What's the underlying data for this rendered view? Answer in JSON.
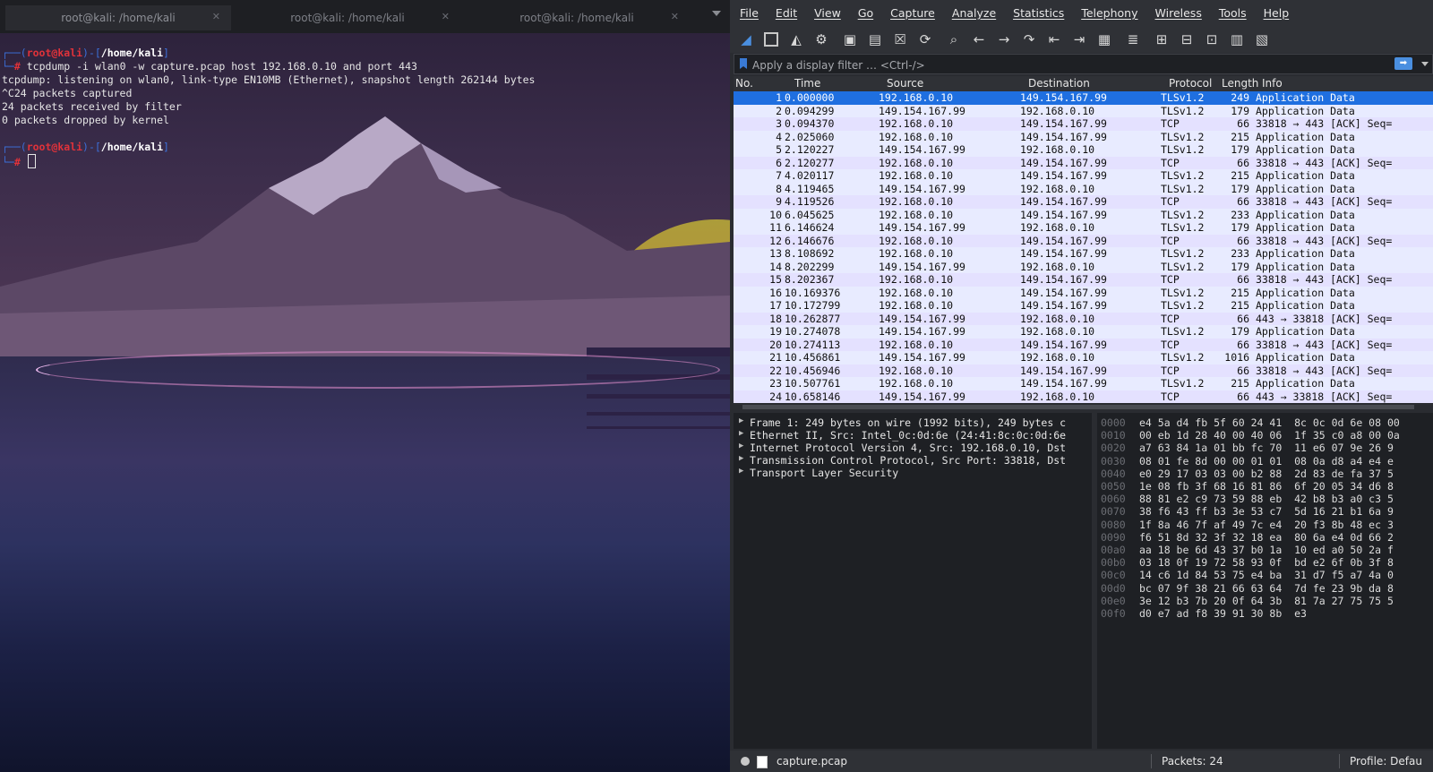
{
  "terminal": {
    "tabs": [
      {
        "label": "root@kali: /home/kali",
        "active": true
      },
      {
        "label": "root@kali: /home/kali",
        "active": false
      },
      {
        "label": "root@kali: /home/kali",
        "active": false
      }
    ],
    "prompt": {
      "user": "root@kali",
      "path": "/home/kali",
      "symbol": "#"
    },
    "command": "tcpdump -i wlan0 -w capture.pcap host 192.168.0.10 and port 443",
    "output": [
      "tcpdump: listening on wlan0, link-type EN10MB (Ethernet), snapshot length 262144 bytes",
      "^C24 packets captured",
      "24 packets received by filter",
      "0 packets dropped by kernel"
    ]
  },
  "wireshark": {
    "menu": [
      "File",
      "Edit",
      "View",
      "Go",
      "Capture",
      "Analyze",
      "Statistics",
      "Telephony",
      "Wireless",
      "Tools",
      "Help"
    ],
    "filter_placeholder": "Apply a display filter … <Ctrl-/>",
    "columns": [
      "No.",
      "Time",
      "Source",
      "Destination",
      "Protocol",
      "Length",
      "Info"
    ],
    "packets": [
      [
        "1",
        "0.000000",
        "192.168.0.10",
        "149.154.167.99",
        "TLSv1.2",
        "249",
        "Application Data"
      ],
      [
        "2",
        "0.094299",
        "149.154.167.99",
        "192.168.0.10",
        "TLSv1.2",
        "179",
        "Application Data"
      ],
      [
        "3",
        "0.094370",
        "192.168.0.10",
        "149.154.167.99",
        "TCP",
        "66",
        "33818 → 443 [ACK] Seq="
      ],
      [
        "4",
        "2.025060",
        "192.168.0.10",
        "149.154.167.99",
        "TLSv1.2",
        "215",
        "Application Data"
      ],
      [
        "5",
        "2.120227",
        "149.154.167.99",
        "192.168.0.10",
        "TLSv1.2",
        "179",
        "Application Data"
      ],
      [
        "6",
        "2.120277",
        "192.168.0.10",
        "149.154.167.99",
        "TCP",
        "66",
        "33818 → 443 [ACK] Seq="
      ],
      [
        "7",
        "4.020117",
        "192.168.0.10",
        "149.154.167.99",
        "TLSv1.2",
        "215",
        "Application Data"
      ],
      [
        "8",
        "4.119465",
        "149.154.167.99",
        "192.168.0.10",
        "TLSv1.2",
        "179",
        "Application Data"
      ],
      [
        "9",
        "4.119526",
        "192.168.0.10",
        "149.154.167.99",
        "TCP",
        "66",
        "33818 → 443 [ACK] Seq="
      ],
      [
        "10",
        "6.045625",
        "192.168.0.10",
        "149.154.167.99",
        "TLSv1.2",
        "233",
        "Application Data"
      ],
      [
        "11",
        "6.146624",
        "149.154.167.99",
        "192.168.0.10",
        "TLSv1.2",
        "179",
        "Application Data"
      ],
      [
        "12",
        "6.146676",
        "192.168.0.10",
        "149.154.167.99",
        "TCP",
        "66",
        "33818 → 443 [ACK] Seq="
      ],
      [
        "13",
        "8.108692",
        "192.168.0.10",
        "149.154.167.99",
        "TLSv1.2",
        "233",
        "Application Data"
      ],
      [
        "14",
        "8.202299",
        "149.154.167.99",
        "192.168.0.10",
        "TLSv1.2",
        "179",
        "Application Data"
      ],
      [
        "15",
        "8.202367",
        "192.168.0.10",
        "149.154.167.99",
        "TCP",
        "66",
        "33818 → 443 [ACK] Seq="
      ],
      [
        "16",
        "10.169376",
        "192.168.0.10",
        "149.154.167.99",
        "TLSv1.2",
        "215",
        "Application Data"
      ],
      [
        "17",
        "10.172799",
        "192.168.0.10",
        "149.154.167.99",
        "TLSv1.2",
        "215",
        "Application Data"
      ],
      [
        "18",
        "10.262877",
        "149.154.167.99",
        "192.168.0.10",
        "TCP",
        "66",
        "443 → 33818 [ACK] Seq="
      ],
      [
        "19",
        "10.274078",
        "149.154.167.99",
        "192.168.0.10",
        "TLSv1.2",
        "179",
        "Application Data"
      ],
      [
        "20",
        "10.274113",
        "192.168.0.10",
        "149.154.167.99",
        "TCP",
        "66",
        "33818 → 443 [ACK] Seq="
      ],
      [
        "21",
        "10.456861",
        "149.154.167.99",
        "192.168.0.10",
        "TLSv1.2",
        "1016",
        "Application Data"
      ],
      [
        "22",
        "10.456946",
        "192.168.0.10",
        "149.154.167.99",
        "TCP",
        "66",
        "33818 → 443 [ACK] Seq="
      ],
      [
        "23",
        "10.507761",
        "192.168.0.10",
        "149.154.167.99",
        "TLSv1.2",
        "215",
        "Application Data"
      ],
      [
        "24",
        "10.658146",
        "149.154.167.99",
        "192.168.0.10",
        "TCP",
        "66",
        "443 → 33818 [ACK] Seq="
      ]
    ],
    "selected_row": 0,
    "details": [
      "Frame 1: 249 bytes on wire (1992 bits), 249 bytes c",
      "Ethernet II, Src: Intel_0c:0d:6e (24:41:8c:0c:0d:6e",
      "Internet Protocol Version 4, Src: 192.168.0.10, Dst",
      "Transmission Control Protocol, Src Port: 33818, Dst",
      "Transport Layer Security"
    ],
    "hex": [
      [
        "0000",
        "e4 5a d4 fb 5f 60 24 41  8c 0c 0d 6e 08 00"
      ],
      [
        "0010",
        "00 eb 1d 28 40 00 40 06  1f 35 c0 a8 00 0a"
      ],
      [
        "0020",
        "a7 63 84 1a 01 bb fc 70  11 e6 07 9e 26 9"
      ],
      [
        "0030",
        "08 01 fe 8d 00 00 01 01  08 0a d8 a4 e4 e"
      ],
      [
        "0040",
        "e0 29 17 03 03 00 b2 88  2d 83 de fa 37 5"
      ],
      [
        "0050",
        "1e 08 fb 3f 68 16 81 86  6f 20 05 34 d6 8"
      ],
      [
        "0060",
        "88 81 e2 c9 73 59 88 eb  42 b8 b3 a0 c3 5"
      ],
      [
        "0070",
        "38 f6 43 ff b3 3e 53 c7  5d 16 21 b1 6a 9"
      ],
      [
        "0080",
        "1f 8a 46 7f af 49 7c e4  20 f3 8b 48 ec 3"
      ],
      [
        "0090",
        "f6 51 8d 32 3f 32 18 ea  80 6a e4 0d 66 2"
      ],
      [
        "00a0",
        "aa 18 be 6d 43 37 b0 1a  10 ed a0 50 2a f"
      ],
      [
        "00b0",
        "03 18 0f 19 72 58 93 0f  bd e2 6f 0b 3f 8"
      ],
      [
        "00c0",
        "14 c6 1d 84 53 75 e4 ba  31 d7 f5 a7 4a 0"
      ],
      [
        "00d0",
        "bc 07 9f 38 21 66 63 64  7d fe 23 9b da 8"
      ],
      [
        "00e0",
        "3e 12 b3 7b 20 0f 64 3b  81 7a 27 75 75 5"
      ],
      [
        "00f0",
        "d0 e7 ad f8 39 91 30 8b  e3"
      ]
    ],
    "status": {
      "file": "capture.pcap",
      "packets": "Packets: 24",
      "profile": "Profile: Defau"
    },
    "colors": {
      "tls_row": "#e8ebff",
      "tcp_row": "#e4e1ff",
      "selected": "#1f6fe0"
    }
  }
}
